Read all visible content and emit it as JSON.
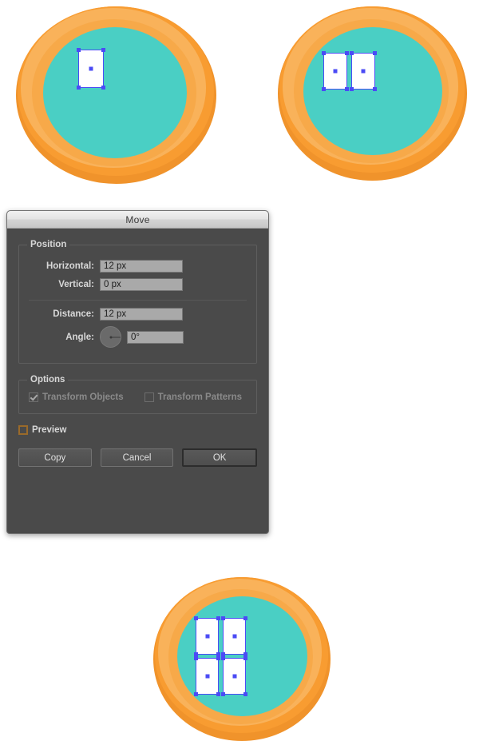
{
  "dialog": {
    "title": "Move",
    "groups": {
      "position": {
        "legend": "Position",
        "horizontal_label": "Horizontal:",
        "horizontal_value": "12 px",
        "vertical_label": "Vertical:",
        "vertical_value": "0 px",
        "distance_label": "Distance:",
        "distance_value": "12 px",
        "angle_label": "Angle:",
        "angle_value": "0°",
        "angle_dial_icon": "angle-dial-icon"
      },
      "options": {
        "legend": "Options",
        "transform_objects_label": "Transform Objects",
        "transform_objects_checked": true,
        "transform_objects_enabled": false,
        "transform_patterns_label": "Transform Patterns",
        "transform_patterns_checked": false,
        "transform_patterns_enabled": false
      }
    },
    "preview_label": "Preview",
    "preview_checked": false,
    "buttons": {
      "copy": "Copy",
      "cancel": "Cancel",
      "ok": "OK"
    },
    "colors": {
      "background": "#4a4a4a",
      "titlebar_top": "#f2f2f2",
      "input_background": "#a9a9a9",
      "preview_highlight": "#9a6a2a"
    }
  },
  "artwork": {
    "colors": {
      "orange_dark": "#f0932b",
      "orange_main": "#f89c31",
      "orange_highlight": "#f9b25a",
      "teal": "#4acfc4",
      "selection_blue": "#4b4bf5",
      "rect_fill": "#ffffff"
    },
    "badges": [
      {
        "name": "badge-top-left",
        "rect_count": 1
      },
      {
        "name": "badge-top-right",
        "rect_count": 2
      },
      {
        "name": "badge-bottom",
        "rect_count": 4
      }
    ]
  }
}
